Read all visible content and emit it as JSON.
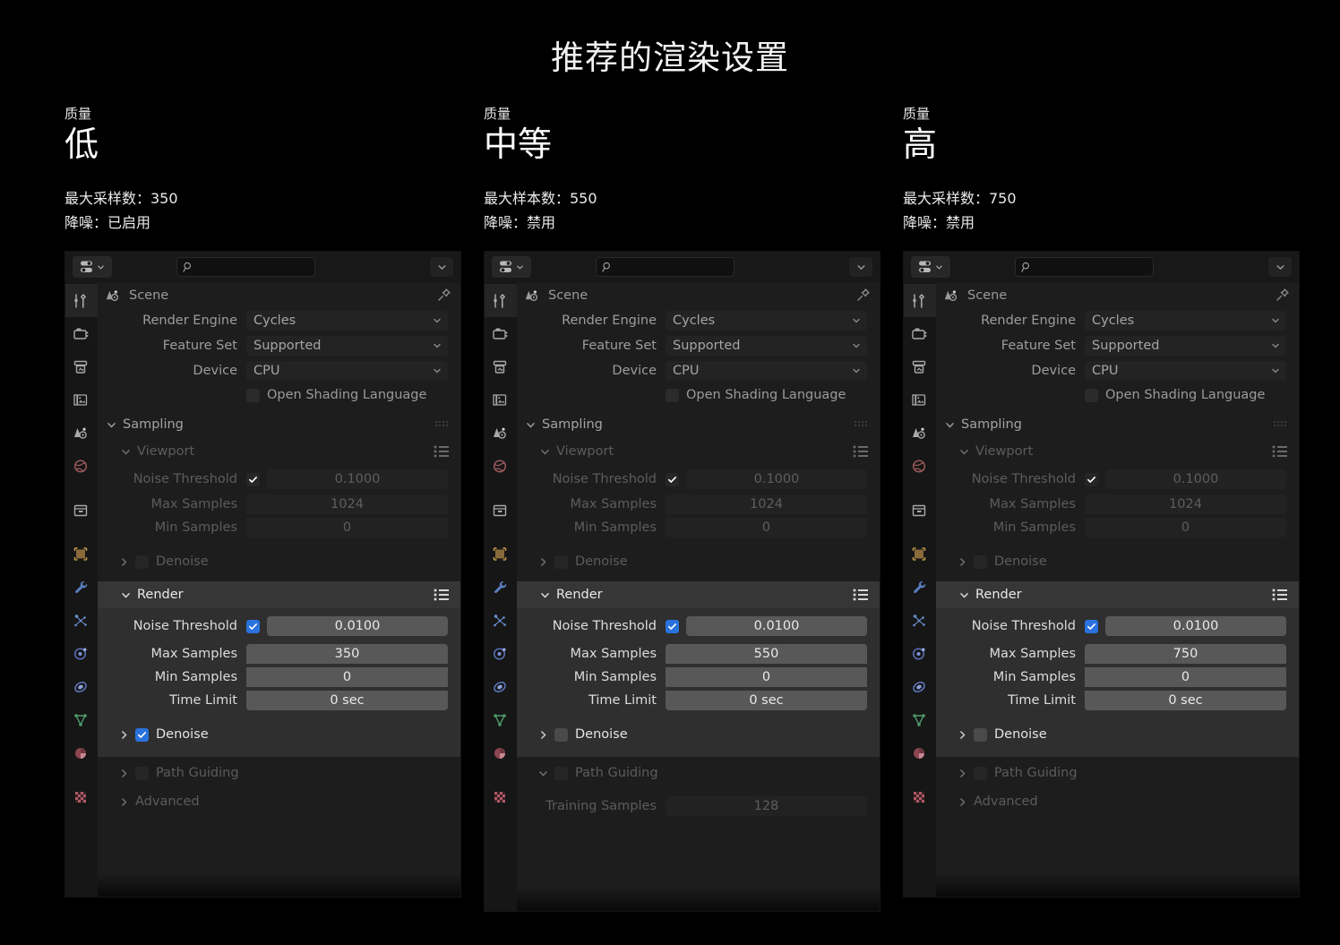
{
  "title": "推荐的渲染设置",
  "columns": [
    {
      "quality_label": "质量",
      "quality_value": "低",
      "max_samples_line": "最大采样数：350",
      "denoise_line": "降噪：已启用",
      "editor": {
        "search_placeholder": "",
        "breadcrumb": "Scene",
        "render_engine_label": "Render Engine",
        "render_engine_value": "Cycles",
        "feature_set_label": "Feature Set",
        "feature_set_value": "Supported",
        "device_label": "Device",
        "device_value": "CPU",
        "osl_label": "Open Shading Language",
        "sampling_title": "Sampling",
        "viewport_title": "Viewport",
        "viewport": {
          "noise_threshold_label": "Noise Threshold",
          "noise_threshold_value": "0.1000",
          "max_samples_label": "Max Samples",
          "max_samples_value": "1024",
          "min_samples_label": "Min Samples",
          "min_samples_value": "0",
          "denoise_label": "Denoise"
        },
        "render_title": "Render",
        "render": {
          "noise_threshold_label": "Noise Threshold",
          "noise_threshold_value": "0.0100",
          "max_samples_label": "Max Samples",
          "max_samples_value": "350",
          "min_samples_label": "Min Samples",
          "min_samples_value": "0",
          "time_limit_label": "Time Limit",
          "time_limit_value": "0 sec",
          "denoise_label": "Denoise",
          "denoise_checked": true
        },
        "path_guiding_title": "Path Guiding",
        "path_guiding_expanded": false,
        "training_samples_label": "",
        "training_samples_value": "",
        "advanced_title": "Advanced"
      }
    },
    {
      "quality_label": "质量",
      "quality_value": "中等",
      "max_samples_line": "最大样本数：550",
      "denoise_line": "降噪：禁用",
      "editor": {
        "search_placeholder": "",
        "breadcrumb": "Scene",
        "render_engine_label": "Render Engine",
        "render_engine_value": "Cycles",
        "feature_set_label": "Feature Set",
        "feature_set_value": "Supported",
        "device_label": "Device",
        "device_value": "CPU",
        "osl_label": "Open Shading Language",
        "sampling_title": "Sampling",
        "viewport_title": "Viewport",
        "viewport": {
          "noise_threshold_label": "Noise Threshold",
          "noise_threshold_value": "0.1000",
          "max_samples_label": "Max Samples",
          "max_samples_value": "1024",
          "min_samples_label": "Min Samples",
          "min_samples_value": "0",
          "denoise_label": "Denoise"
        },
        "render_title": "Render",
        "render": {
          "noise_threshold_label": "Noise Threshold",
          "noise_threshold_value": "0.0100",
          "max_samples_label": "Max Samples",
          "max_samples_value": "550",
          "min_samples_label": "Min Samples",
          "min_samples_value": "0",
          "time_limit_label": "Time Limit",
          "time_limit_value": "0 sec",
          "denoise_label": "Denoise",
          "denoise_checked": false
        },
        "path_guiding_title": "Path Guiding",
        "path_guiding_expanded": true,
        "training_samples_label": "Training Samples",
        "training_samples_value": "128",
        "advanced_title": ""
      }
    },
    {
      "quality_label": "质量",
      "quality_value": "高",
      "max_samples_line": "最大采样数：750",
      "denoise_line": "降噪：禁用",
      "editor": {
        "search_placeholder": "",
        "breadcrumb": "Scene",
        "render_engine_label": "Render Engine",
        "render_engine_value": "Cycles",
        "feature_set_label": "Feature Set",
        "feature_set_value": "Supported",
        "device_label": "Device",
        "device_value": "CPU",
        "osl_label": "Open Shading Language",
        "sampling_title": "Sampling",
        "viewport_title": "Viewport",
        "viewport": {
          "noise_threshold_label": "Noise Threshold",
          "noise_threshold_value": "0.1000",
          "max_samples_label": "Max Samples",
          "max_samples_value": "1024",
          "min_samples_label": "Min Samples",
          "min_samples_value": "0",
          "denoise_label": "Denoise"
        },
        "render_title": "Render",
        "render": {
          "noise_threshold_label": "Noise Threshold",
          "noise_threshold_value": "0.0100",
          "max_samples_label": "Max Samples",
          "max_samples_value": "750",
          "min_samples_label": "Min Samples",
          "min_samples_value": "0",
          "time_limit_label": "Time Limit",
          "time_limit_value": "0 sec",
          "denoise_label": "Denoise",
          "denoise_checked": false
        },
        "path_guiding_title": "Path Guiding",
        "path_guiding_expanded": false,
        "training_samples_label": "",
        "training_samples_value": "",
        "advanced_title": "Advanced"
      }
    }
  ],
  "tab_rail_icons": [
    "tool-icon",
    "render-camera-icon",
    "output-printer-icon",
    "view-layer-images-icon",
    "scene-icon",
    "world-globe-icon",
    "collection-box-icon",
    "object-square-icon",
    "modifier-wrench-icon",
    "particles-icon",
    "physics-orbit-icon",
    "constraints-icon",
    "object-data-triangle-icon",
    "material-sphere-icon",
    "texture-checker-icon"
  ],
  "colors": {
    "background": "#000000",
    "editor_bg": "#1d1d1d",
    "header_bg": "#181818",
    "rail_bg": "#161616",
    "highlight_panel_bg": "#2f2f2f",
    "highlight_header_bg": "#363636",
    "field_bg": "#232323",
    "field_bg_active": "#585858",
    "checkbox_on": "#2a6fd4",
    "text_dim": "#9a9a9a",
    "text_bright": "#e8e8e8"
  }
}
